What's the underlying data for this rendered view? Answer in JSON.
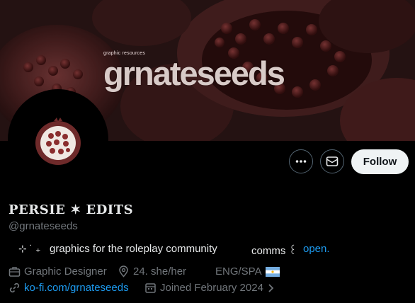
{
  "banner": {
    "small_text": "graphic resources",
    "title": "grnateseeds"
  },
  "actions": {
    "more_icon": "more-icon",
    "message_icon": "envelope-icon",
    "follow_label": "Follow"
  },
  "profile": {
    "display_name": "PERSIE ✶ EDITS",
    "handle": "@grnateseeds",
    "bio_sparkles": "⊹ ˙ ₊",
    "bio_text": "graphics for the roleplay community",
    "bio_comms": "comms ꒰",
    "bio_open": "open.",
    "profession": "Graphic Designer",
    "location": "24. she/her",
    "languages": "ENG/SPA",
    "website": "ko-fi.com/grnateseeds",
    "joined": "Joined February 2024"
  },
  "colors": {
    "link": "#1d9bf0",
    "muted": "#71767b",
    "text": "#e7e9ea",
    "follow_bg": "#eff3f4"
  }
}
